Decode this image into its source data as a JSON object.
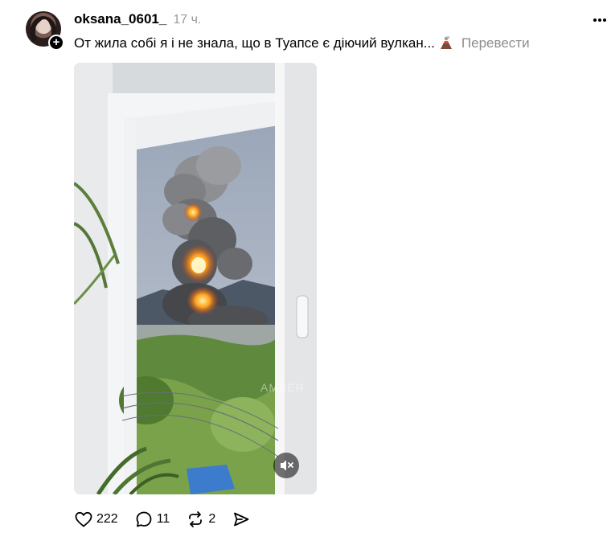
{
  "post": {
    "username": "oksana_0601_",
    "timestamp": "17 ч.",
    "caption": "От жила собі я і не знала, що в Туапсе є діючий вулкан...",
    "caption_emoji": "volcano-icon",
    "translate_label": "Перевести",
    "follow_badge": "+",
    "media": {
      "watermark": "AMBER",
      "mute_icon": "speaker-muted-icon"
    }
  },
  "actions": {
    "likes": "222",
    "comments": "11",
    "reposts": "2"
  },
  "colors": {
    "text": "#000000",
    "muted": "#9a9a9a",
    "background": "#ffffff",
    "fire": "#ff8a1a"
  }
}
